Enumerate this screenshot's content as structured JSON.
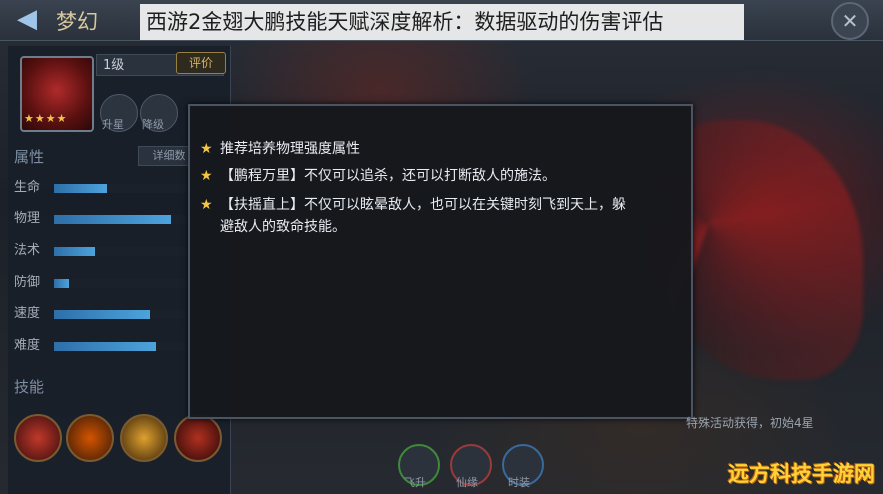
{
  "header": {
    "caption_left": "梦幻",
    "caption": "西游2金翅大鹏技能天赋深度解析：数据驱动的伤害评估",
    "close_label": "✕"
  },
  "character": {
    "level": "1级",
    "rate_label": "评价",
    "stars": "★★★★",
    "mini_buttons": [
      "升星",
      "降级"
    ]
  },
  "attributes": {
    "title": "属性",
    "detail_button": "详细数",
    "stats": [
      {
        "label": "生命",
        "value": 0.35
      },
      {
        "label": "物理",
        "value": 0.78
      },
      {
        "label": "法术",
        "value": 0.27
      },
      {
        "label": "防御",
        "value": 0.1
      },
      {
        "label": "速度",
        "value": 0.64
      },
      {
        "label": "难度",
        "value": 0.68
      }
    ]
  },
  "skills": {
    "title": "技能"
  },
  "popup": {
    "lines": [
      "推荐培养物理强度属性",
      "【鹏程万里】不仅可以追杀，还可以打断敌人的施法。",
      "【扶摇直上】不仅可以眩晕敌人，也可以在关键时刻飞到天上，躲避敌人的致命技能。"
    ]
  },
  "bottom": {
    "buttons": [
      "飞升",
      "仙缘",
      "时装"
    ],
    "note": "特殊活动获得，初始4星"
  },
  "watermark": "远方科技手游网",
  "colors": {
    "star": "#f2c744",
    "stat_bar": "#4da3dd",
    "watermark": "#ffd23a"
  }
}
